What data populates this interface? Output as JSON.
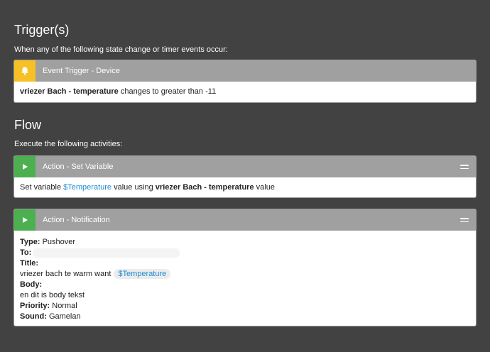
{
  "trigger": {
    "title": "Trigger(s)",
    "subtitle": "When any of the following state change or timer events occur:",
    "card": {
      "icon": "bell-icon",
      "title": "Event Trigger - Device",
      "device": "vriezer Bach",
      "sep": " - ",
      "attribute": "temperature",
      "rest": " changes to greater than -11"
    }
  },
  "flow": {
    "title": "Flow",
    "subtitle": "Execute the following activities:",
    "set_variable": {
      "icon": "play-icon",
      "title": "Action - Set Variable",
      "prefix": "Set variable ",
      "variable": "$Temperature",
      "middle": " value using ",
      "device": "vriezer Bach - temperature",
      "suffix": " value"
    },
    "notification": {
      "icon": "play-icon",
      "title": "Action - Notification",
      "type_label": "Type:",
      "type_value": " Pushover",
      "to_label": "To:",
      "title_label": "Title:",
      "title_text": "vriezer bach te warm want",
      "title_var": "$Temperature",
      "body_label": "Body:",
      "body_text": "en dit is body tekst",
      "priority_label": "Priority:",
      "priority_value": " Normal",
      "sound_label": "Sound:",
      "sound_value": " Gamelan"
    }
  },
  "colors": {
    "background": "#424242",
    "card_header": "#a0a0a0",
    "trigger_icon": "#f6c026",
    "action_icon": "#4caf50",
    "variable": "#1e8ed0"
  }
}
